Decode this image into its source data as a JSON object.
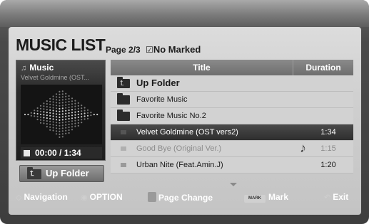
{
  "header": {
    "title": "MUSIC LIST",
    "page": "Page 2/3",
    "marked": "No Marked"
  },
  "now_playing": {
    "label": "Music",
    "track": "Velvet Goldmine (OST...",
    "time": "00:00 / 1:34"
  },
  "up_folder_button": "Up Folder",
  "list": {
    "columns": [
      "Title",
      "Duration"
    ],
    "rows": [
      {
        "type": "up-folder",
        "title": "Up Folder",
        "duration": ""
      },
      {
        "type": "folder",
        "title": "Favorite Music",
        "duration": ""
      },
      {
        "type": "folder",
        "title": "Favorite Music No.2",
        "duration": ""
      },
      {
        "type": "track",
        "title": "Velvet Goldmine (OST vers2)",
        "duration": "1:34",
        "state": "selected"
      },
      {
        "type": "track",
        "title": "Good Bye (Original Ver.)",
        "duration": "1:15",
        "state": "playing"
      },
      {
        "type": "track",
        "title": "Urban Nite (Feat.Amin.J)",
        "duration": "1:20",
        "state": "normal"
      }
    ]
  },
  "footer": {
    "navigation": "Navigation",
    "option": "OPTION",
    "page_change": "Page Change",
    "mark_chip": "MARK",
    "mark": "Mark",
    "exit": "Exit"
  },
  "colors": {
    "selected_row": "#3a3a3a",
    "panel": "#cfcfcf",
    "header": "#7c7c7c"
  }
}
